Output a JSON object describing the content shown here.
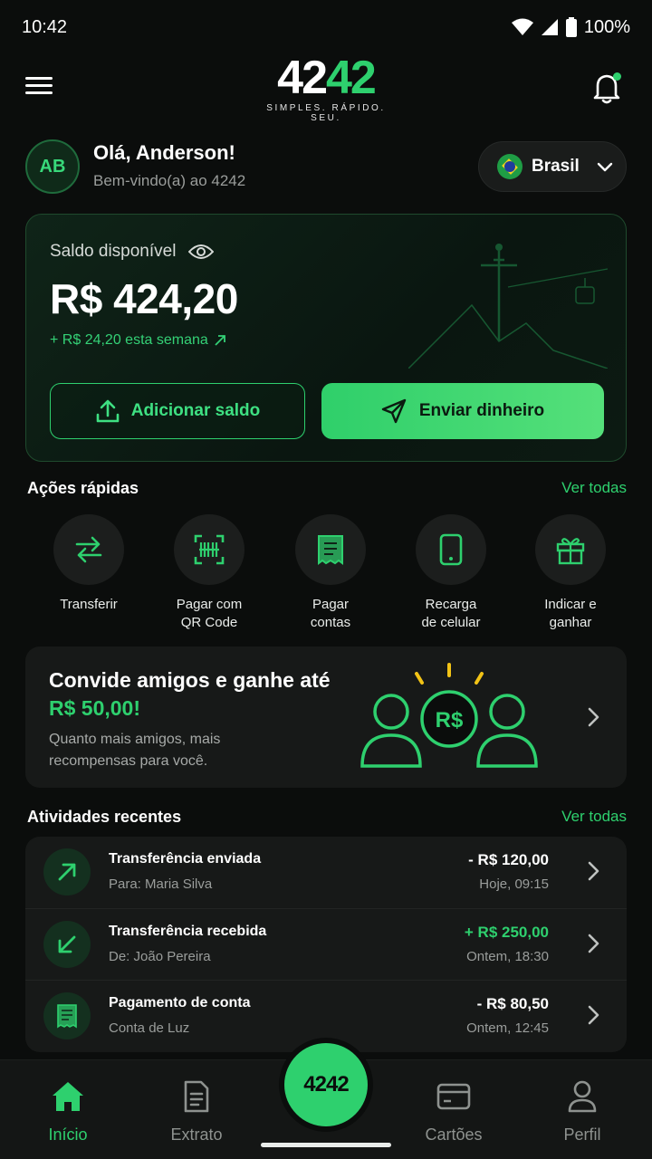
{
  "status_bar": {
    "time": "10:42",
    "battery": "100%"
  },
  "header": {
    "logo_main_white": "42",
    "logo_main_green": "42",
    "logo_tagline": "SIMPLES. RÁPIDO. SEU."
  },
  "greeting": {
    "avatar_initials": "AB",
    "title": "Olá, Anderson!",
    "subtitle": "Bem-vindo(a) ao 4242",
    "country": "Brasil"
  },
  "balance": {
    "label": "Saldo disponível",
    "value": "R$ 424,20",
    "week_change": "+ R$ 24,20 esta semana",
    "add_label": "Adicionar saldo",
    "send_label": "Enviar dinheiro"
  },
  "quick_actions": {
    "title": "Ações rápidas",
    "see_all": "Ver todas",
    "items": [
      {
        "label": "Transferir",
        "icon": "transfer-arrows-icon"
      },
      {
        "label": "Pagar com\nQR Code",
        "icon": "qr-code-icon"
      },
      {
        "label": "Pagar\ncontas",
        "icon": "bill-receipt-icon"
      },
      {
        "label": "Recarga\nde celular",
        "icon": "phone-icon"
      },
      {
        "label": "Indicar e\nganhar",
        "icon": "gift-icon"
      }
    ]
  },
  "invite": {
    "title_prefix": "Convide amigos e ganhe até ",
    "title_amount": "R$ 50,00!",
    "subtitle": "Quanto mais amigos, mais recompensas para você.",
    "art_coin": "R$"
  },
  "recent": {
    "title": "Atividades recentes",
    "see_all": "Ver todas",
    "items": [
      {
        "title": "Transferência enviada",
        "sub": "Para: Maria Silva",
        "amount": "- R$ 120,00",
        "time": "Hoje, 09:15",
        "positive": false
      },
      {
        "title": "Transferência recebida",
        "sub": "De: João Pereira",
        "amount": "+ R$ 250,00",
        "time": "Ontem, 18:30",
        "positive": true
      },
      {
        "title": "Pagamento de conta",
        "sub": "Conta de Luz",
        "amount": "- R$ 80,50",
        "time": "Ontem, 12:45",
        "positive": false
      }
    ]
  },
  "nav": {
    "items": [
      {
        "label": "Início",
        "active": true
      },
      {
        "label": "Extrato",
        "active": false
      },
      {
        "label": "Cartões",
        "active": false
      },
      {
        "label": "Perfil",
        "active": false
      }
    ],
    "fab_label": "4242"
  },
  "colors": {
    "accent": "#2ed06e",
    "background": "#0b0d0c",
    "card": "#171918"
  }
}
